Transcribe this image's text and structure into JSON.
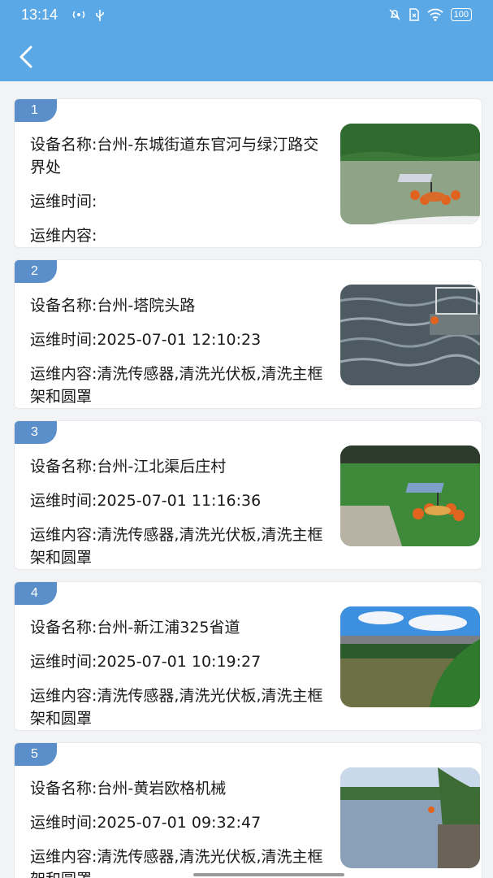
{
  "status": {
    "time": "13:14",
    "battery": "100"
  },
  "items": [
    {
      "index": "1",
      "name": "设备名称:台州-东城街道东官河与绿汀路交界处",
      "time": "运维时间:",
      "content": "运维内容:"
    },
    {
      "index": "2",
      "name": "设备名称:台州-塔院头路",
      "time": "运维时间:2025-07-01 12:10:23",
      "content": "运维内容:清洗传感器,清洗光伏板,清洗主框架和圆罩"
    },
    {
      "index": "3",
      "name": "设备名称:台州-江北渠后庄村",
      "time": "运维时间:2025-07-01 11:16:36",
      "content": "运维内容:清洗传感器,清洗光伏板,清洗主框架和圆罩"
    },
    {
      "index": "4",
      "name": "设备名称:台州-新江浦325省道",
      "time": "运维时间:2025-07-01 10:19:27",
      "content": "运维内容:清洗传感器,清洗光伏板,清洗主框架和圆罩"
    },
    {
      "index": "5",
      "name": "设备名称:台州-黄岩欧格机械",
      "time": "运维时间:2025-07-01 09:32:47",
      "content": "运维内容:清洗传感器,清洗光伏板,清洗主框架和圆罩"
    }
  ],
  "colors": {
    "header": "#5aa8e6",
    "badge": "#5b8fc9"
  },
  "icons": {
    "back": "chevron-left-icon"
  }
}
